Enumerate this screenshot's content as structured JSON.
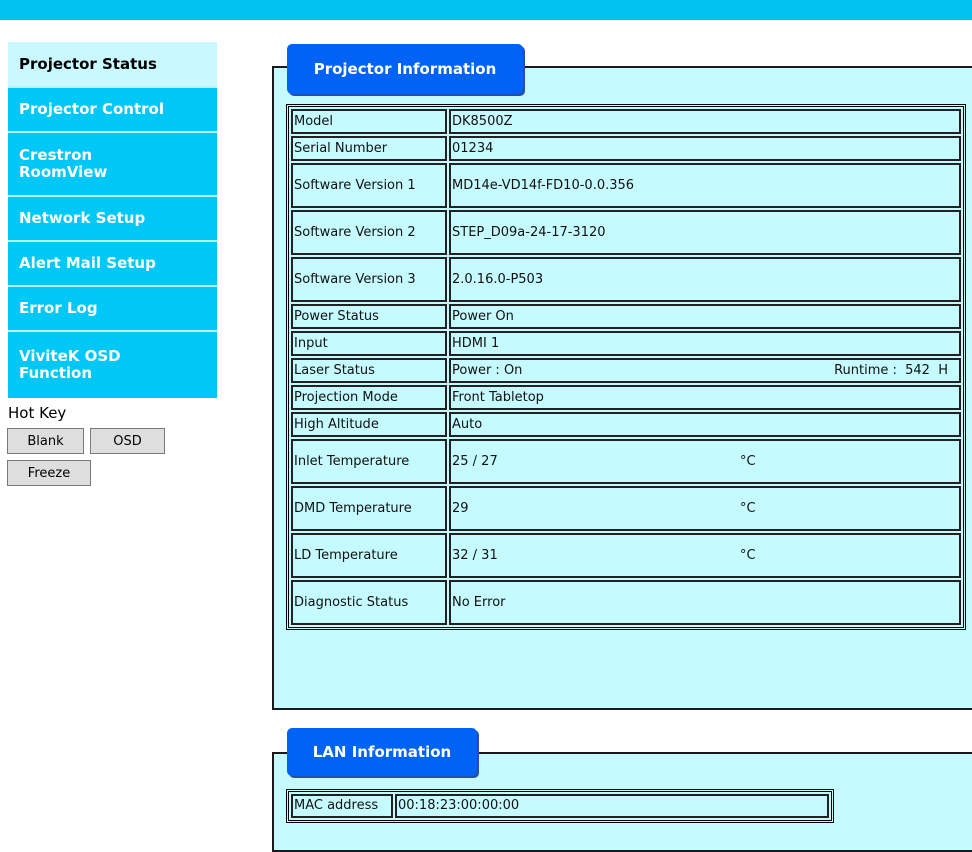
{
  "nav": {
    "items": [
      {
        "label": "Projector Status",
        "active": true
      },
      {
        "label": "Projector Control",
        "active": false
      },
      {
        "label": "Crestron RoomView",
        "active": false
      },
      {
        "label": "Network Setup",
        "active": false
      },
      {
        "label": "Alert Mail Setup",
        "active": false
      },
      {
        "label": "Error Log",
        "active": false
      },
      {
        "label": "ViviteK OSD Function",
        "active": false
      }
    ]
  },
  "hotkey": {
    "label": "Hot Key",
    "blank": "Blank",
    "osd": "OSD",
    "freeze": "Freeze"
  },
  "projector_info": {
    "title": "Projector Information",
    "rows": [
      {
        "label": "Model",
        "value": "DK8500Z"
      },
      {
        "label": "Serial Number",
        "value": "01234"
      },
      {
        "label": "Software Version 1",
        "value": "MD14e-VD14f-FD10-0.0.356"
      },
      {
        "label": "Software Version 2",
        "value": "STEP_D09a-24-17-3120"
      },
      {
        "label": "Software Version 3",
        "value": "2.0.16.0-P503"
      },
      {
        "label": "Power Status",
        "value": "Power On"
      },
      {
        "label": "Input",
        "value": "HDMI 1"
      },
      {
        "label": "Laser Status",
        "value": "Power : On",
        "extra": "Runtime :  542  H"
      },
      {
        "label": "Projection Mode",
        "value": "Front Tabletop"
      },
      {
        "label": "High Altitude",
        "value": "Auto"
      },
      {
        "label": "Inlet Temperature",
        "value": "25 / 27",
        "unit": "°C"
      },
      {
        "label": "DMD Temperature",
        "value": "29",
        "unit": "°C"
      },
      {
        "label": "LD Temperature",
        "value": "32 / 31",
        "unit": "°C"
      },
      {
        "label": "Diagnostic Status",
        "value": "No Error"
      }
    ]
  },
  "lan_info": {
    "title": "LAN Information",
    "rows": [
      {
        "label": "MAC address",
        "value": "00:18:23:00:00:00"
      }
    ]
  },
  "colors": {
    "top_bar": "#00c3ef",
    "nav_bg": "#00c8f6",
    "nav_active_bg": "#c9f8ff",
    "panel_bg": "#c5fbff",
    "tab_bg": "#0063f5"
  }
}
